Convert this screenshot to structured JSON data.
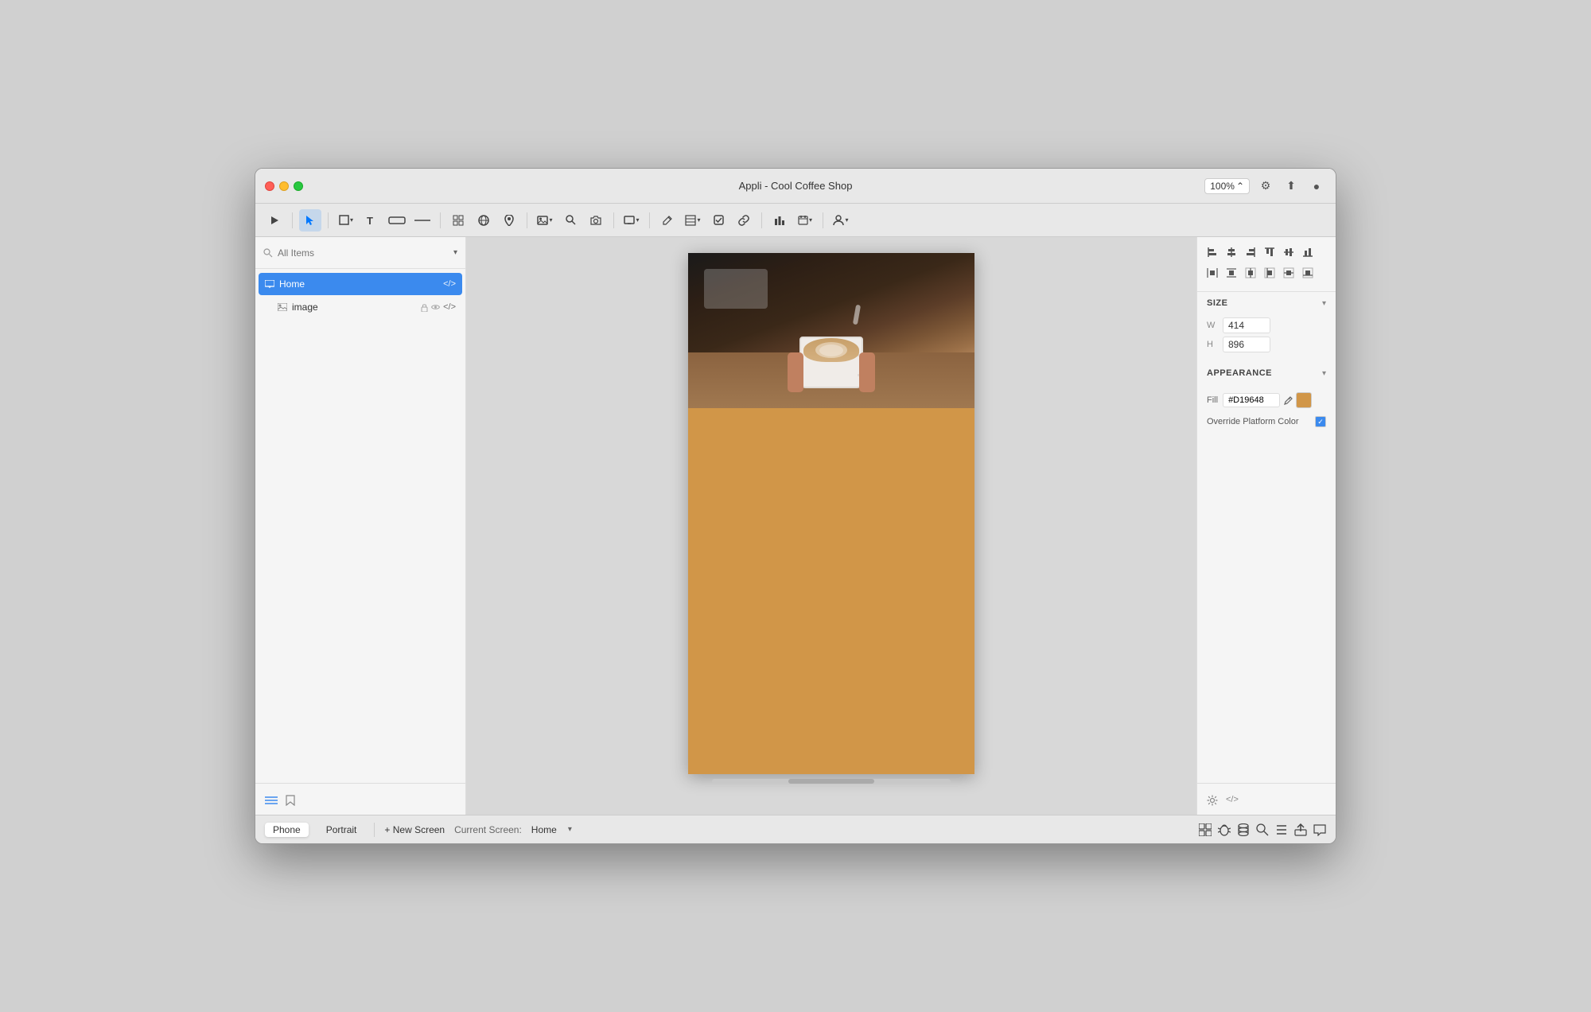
{
  "window": {
    "title": "Appli - Cool Coffee Shop"
  },
  "traffic_lights": {
    "red": "close",
    "yellow": "minimize",
    "green": "maximize"
  },
  "toolbar": {
    "zoom": "100%",
    "tools": [
      {
        "name": "play",
        "icon": "▶",
        "label": "Play"
      },
      {
        "name": "select",
        "icon": "↖",
        "label": "Select",
        "active": true
      },
      {
        "name": "rectangle",
        "icon": "□",
        "label": "Rectangle"
      },
      {
        "name": "text",
        "icon": "T",
        "label": "Text"
      },
      {
        "name": "input",
        "icon": "—",
        "label": "Input"
      },
      {
        "name": "line",
        "icon": "—",
        "label": "Line"
      },
      {
        "name": "grid",
        "icon": "⊞",
        "label": "Grid"
      },
      {
        "name": "globe",
        "icon": "🌐",
        "label": "Globe"
      },
      {
        "name": "pin",
        "icon": "📍",
        "label": "Pin"
      },
      {
        "name": "image-icon",
        "icon": "🖼",
        "label": "Image"
      },
      {
        "name": "search",
        "icon": "🔍",
        "label": "Search"
      },
      {
        "name": "camera",
        "icon": "📷",
        "label": "Camera"
      },
      {
        "name": "gallery",
        "icon": "🖼",
        "label": "Gallery"
      },
      {
        "name": "screen",
        "icon": "📺",
        "label": "Screen"
      },
      {
        "name": "edit",
        "icon": "✏️",
        "label": "Edit"
      },
      {
        "name": "component",
        "icon": "⊟",
        "label": "Component"
      },
      {
        "name": "check",
        "icon": "☑",
        "label": "Check"
      },
      {
        "name": "link",
        "icon": "🔗",
        "label": "Link"
      },
      {
        "name": "chart",
        "icon": "📊",
        "label": "Chart"
      },
      {
        "name": "calendar",
        "icon": "📅",
        "label": "Calendar"
      },
      {
        "name": "user",
        "icon": "👤",
        "label": "User"
      }
    ]
  },
  "left_panel": {
    "search_placeholder": "All Items",
    "layers": [
      {
        "id": "home",
        "name": "Home",
        "icon": "screen",
        "selected": true,
        "has_code": true
      },
      {
        "id": "image",
        "name": "image",
        "icon": "image",
        "child": true,
        "has_lock": true,
        "has_eye": true,
        "has_code": true
      }
    ],
    "bottom_icons": [
      {
        "name": "list-icon",
        "icon": "≡",
        "active": true
      },
      {
        "name": "bookmark-icon",
        "icon": "🔖",
        "active": false
      }
    ]
  },
  "canvas": {
    "phone_width": 414,
    "phone_height": 896,
    "image_fill_color": "#D19648",
    "image_section_height": 195,
    "orange_section_height": 460
  },
  "right_panel": {
    "alignment": {
      "rows": [
        [
          "align-left-edges",
          "align-center-h",
          "align-right-edges",
          "align-top-edges",
          "align-center-v",
          "align-bottom-edges"
        ],
        [
          "distribute-h",
          "distribute-v",
          "align-center-page-h",
          "align-left-page",
          "align-center-page-v",
          "align-bottom-page"
        ]
      ]
    },
    "size": {
      "label": "SIZE",
      "width_label": "W",
      "width_value": "414",
      "height_label": "H",
      "height_value": "896"
    },
    "appearance": {
      "label": "APPEARANCE",
      "fill_label": "Fill",
      "fill_hex": "#D19648",
      "fill_color": "#D19648",
      "override_label": "Override Platform Color",
      "override_checked": true
    },
    "bottom_icons": [
      {
        "name": "settings-icon",
        "icon": "⚙"
      },
      {
        "name": "code-icon",
        "icon": "</>"
      }
    ]
  },
  "bottom_bar": {
    "device_tab": "Phone",
    "orientation_tab": "Portrait",
    "add_screen_label": "+ New Screen",
    "current_screen_label": "Current Screen:",
    "current_screen_value": "Home",
    "icons": [
      {
        "name": "grid-icon",
        "icon": "⊞"
      },
      {
        "name": "bug-icon",
        "icon": "🐛"
      },
      {
        "name": "database-icon",
        "icon": "🗄"
      },
      {
        "name": "search-db-icon",
        "icon": "🔎"
      },
      {
        "name": "list-icon",
        "icon": "≡"
      },
      {
        "name": "export-icon",
        "icon": "📤"
      },
      {
        "name": "chat-icon",
        "icon": "💬"
      }
    ]
  }
}
